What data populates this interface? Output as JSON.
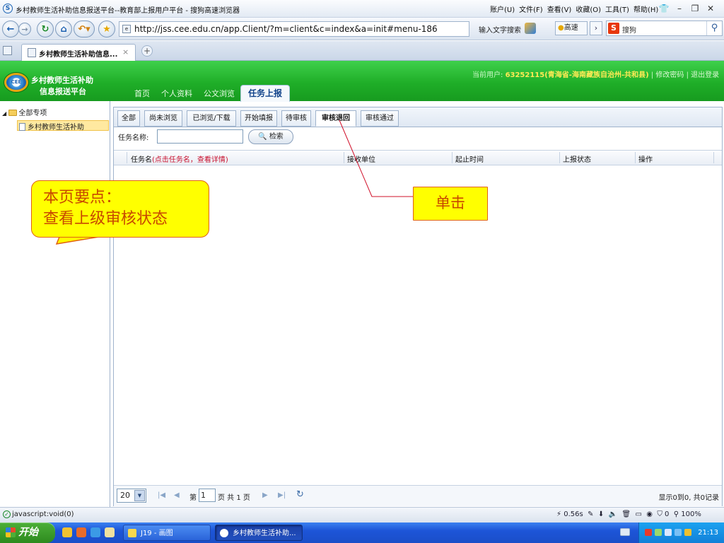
{
  "browser": {
    "window_title": "乡村教师生活补助信息报送平台--教育部上报用户平台 - 搜狗高速浏览器",
    "menus": [
      "账户(U)",
      "文件(F)",
      "查看(V)",
      "收藏(O)",
      "工具(T)",
      "帮助(H)"
    ],
    "url": "http://jss.cee.edu.cn/app.Client/?m=client&c=index&a=init#menu-186",
    "search_hint": "输入文字搜索",
    "speed_label": "高速",
    "search_engine": "搜狗",
    "tab_label": "乡村教师生活补助信息...",
    "status_text": "javascript:void(0)",
    "status_right": "0.56s",
    "zoom": "100%",
    "status_count": "0"
  },
  "app": {
    "name_line1": "乡村教师生活补助",
    "name_line2": "信息报送平台",
    "logo_text": "CEE",
    "user_prefix": "当前用户:",
    "user_id": "63252115(青海省-海南藏族自治州-共和县)",
    "change_password": "修改密码",
    "logout": "退出登录",
    "nav": [
      "首页",
      "个人资料",
      "公文浏览"
    ],
    "nav_active": "任务上报"
  },
  "tree": {
    "root": "全部专项",
    "child": "乡村教师生活补助"
  },
  "subtabs": [
    "全部",
    "尚未浏览",
    "已浏览/下载",
    "开始填报",
    "待审核",
    "审核退回",
    "审核通过"
  ],
  "active_subtab": "审核退回",
  "search": {
    "label": "任务名称:",
    "value": "",
    "button": "检索"
  },
  "grid": {
    "col_name": "任务名",
    "col_name_hint": "(点击任务名，查看详情)",
    "col_unit": "接收单位",
    "col_time": "起止时间",
    "col_status": "上报状态",
    "col_action": "操作",
    "rows": []
  },
  "pager": {
    "page_size": "20",
    "page_prefix": "第",
    "page": "1",
    "page_suffix": "页 共 1 页",
    "summary": "显示0到0, 共0记录"
  },
  "annotations": {
    "note_line1": "本页要点：",
    "note_line2": "查看上级审核状态",
    "click_label": "单击"
  },
  "taskbar": {
    "start": "开始",
    "task1": "J19 - 画图",
    "task2": "乡村教师生活补助...",
    "clock": "21:13"
  }
}
